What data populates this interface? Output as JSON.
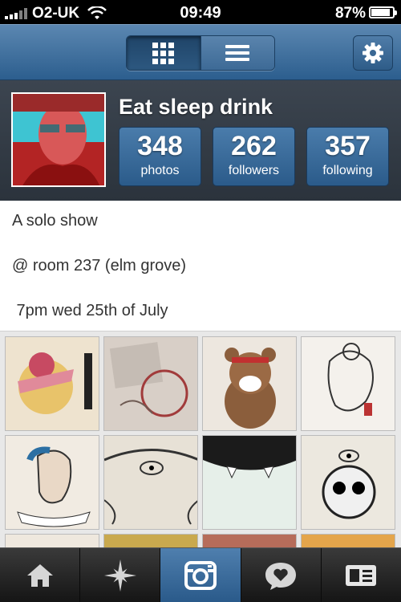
{
  "status_bar": {
    "carrier": "O2-UK",
    "time": "09:49",
    "battery": "87%"
  },
  "profile": {
    "username": "Eat sleep drink",
    "stats": [
      {
        "value": "348",
        "label": "photos"
      },
      {
        "value": "262",
        "label": "followers"
      },
      {
        "value": "357",
        "label": "following"
      }
    ]
  },
  "bio": {
    "lines": [
      "A solo show",
      "@ room 237 (elm grove)",
      " 7pm wed 25th of July"
    ]
  },
  "icons": {
    "nav": [
      "grid-view-icon",
      "list-view-icon",
      "gear-icon"
    ],
    "tabs": [
      "home-icon",
      "explore-star-icon",
      "camera-icon",
      "news-heart-bubble-icon",
      "profile-card-icon"
    ]
  },
  "colors": {
    "accent_blue": "#2c5e8e",
    "tab_active": "#3d6e9e"
  }
}
